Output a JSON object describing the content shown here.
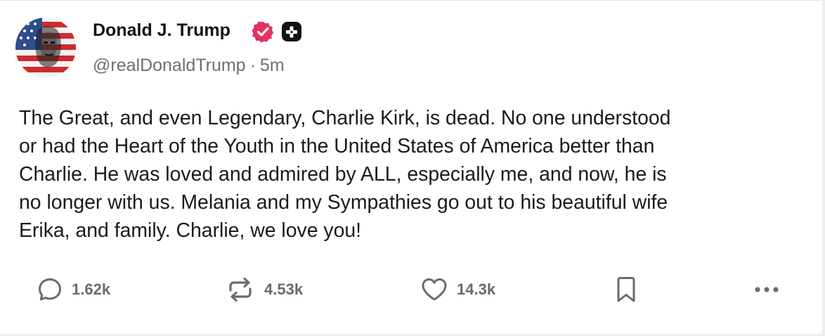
{
  "post": {
    "author_name": "Donald J. Trump",
    "handle": "@realDonaldTrump",
    "separator": "·",
    "time": "5m",
    "body": "The Great, and even Legendary, Charlie Kirk, is dead. No one understood\nor had the Heart of the Youth in the United States of America better than\nCharlie. He was loved and admired by ALL, especially me, and now, he is\nno longer with us. Melania and my Sympathies go out to his beautiful wife\nErika, and family. Charlie, we love you!"
  },
  "actions": {
    "replies": "1.62k",
    "reposts": "4.53k",
    "likes": "14.3k"
  },
  "icons": {
    "avatar": "profile-avatar",
    "verified": "verified-badge-icon",
    "premium": "plus-badge-icon",
    "reply": "comment-icon",
    "repost": "repost-icon",
    "like": "heart-icon",
    "bookmark": "bookmark-icon",
    "more": "more-icon"
  },
  "colors": {
    "verified_badge": "#e0335f",
    "premium_badge": "#111111",
    "text": "#1b1b1b",
    "muted": "#6f6f75"
  }
}
